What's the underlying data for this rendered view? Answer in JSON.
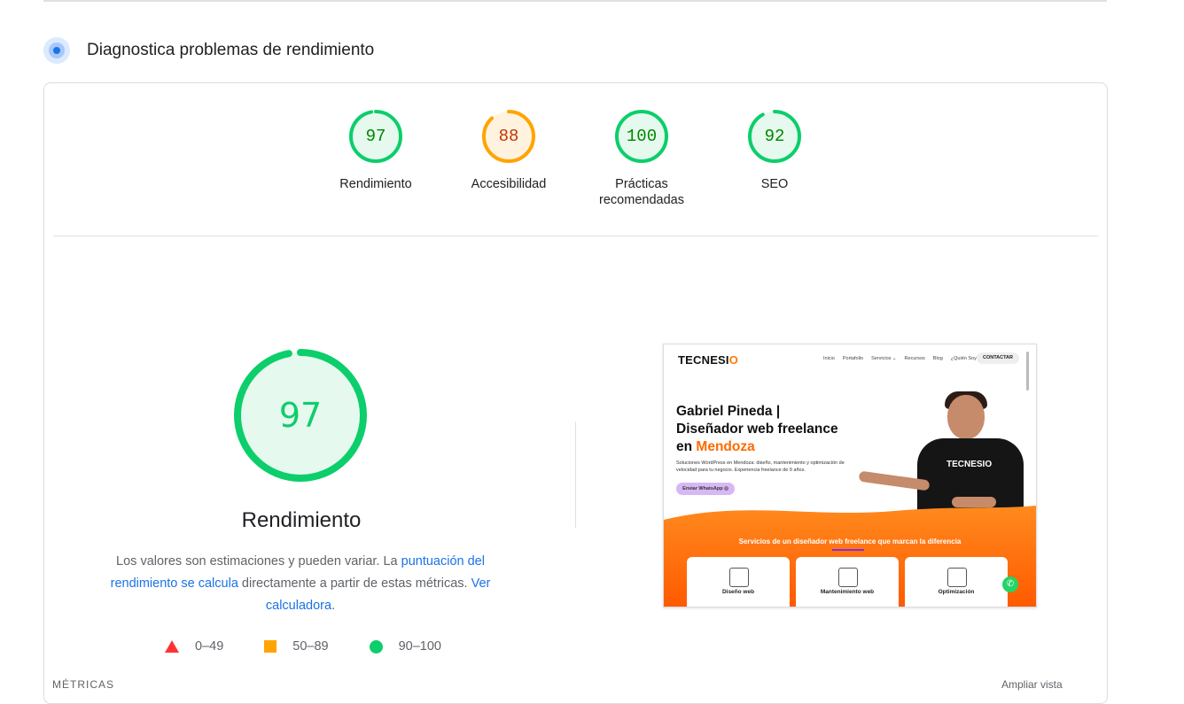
{
  "section": {
    "title": "Diagnostica problemas de rendimiento",
    "icon": "diagnostic-icon"
  },
  "summary_gauges": [
    {
      "score": "97",
      "label": "Rendimiento",
      "status": "pass",
      "color": "#0cce6b",
      "text_color": "#008800",
      "fraction": 0.97
    },
    {
      "score": "88",
      "label": "Accesibilidad",
      "status": "average",
      "color": "#ffa400",
      "text_color": "#c33300",
      "fraction": 0.88
    },
    {
      "score": "100",
      "label": "Prácticas recomendadas",
      "status": "pass",
      "color": "#0cce6b",
      "text_color": "#008800",
      "fraction": 1.0
    },
    {
      "score": "92",
      "label": "SEO",
      "status": "pass",
      "color": "#0cce6b",
      "text_color": "#008800",
      "fraction": 0.92
    }
  ],
  "performance": {
    "score": "97",
    "fraction": 0.97,
    "title": "Rendimiento",
    "description_1": "Los valores son estimaciones y pueden variar. La ",
    "link_1": "puntuación del rendimiento se calcula",
    "description_2": " directamente a partir de estas métricas. ",
    "link_2": "Ver calculadora",
    "description_3": "."
  },
  "legend": [
    {
      "range": "0–49",
      "shape": "triangle",
      "color": "#ff3333"
    },
    {
      "range": "50–89",
      "shape": "square",
      "color": "#ffa400"
    },
    {
      "range": "90–100",
      "shape": "circle",
      "color": "#0cce6b"
    }
  ],
  "screenshot": {
    "logo": "TECNESI",
    "logo_accent": "O",
    "nav": [
      "Inicio",
      "Portafolio",
      "Servicios ⌄",
      "Recursos",
      "Blog",
      "¿Quién Soy?"
    ],
    "cta": "CONTACTAR",
    "headline_1": "Gabriel Pineda |",
    "headline_2": "Diseñador web freelance",
    "headline_3": "en ",
    "headline_accent": "Mendoza",
    "subtext": "Soluciones WordPress en Mendoza: diseño, mantenimiento y optimización de velocidad para tu negocio. Experiencia freelance de 9 años.",
    "button": "Enviar WhatsApp ◎",
    "shirt_text": "TECNESIO",
    "services_heading": "Servicios de un diseñador web freelance que marcan la diferencia",
    "cards": [
      "Diseño web",
      "Mantenimiento web",
      "Optimización"
    ],
    "whatsapp_icon": "whatsapp-icon"
  },
  "footer": {
    "metrics_label": "MÉTRICAS",
    "expand_label": "Ampliar vista"
  }
}
